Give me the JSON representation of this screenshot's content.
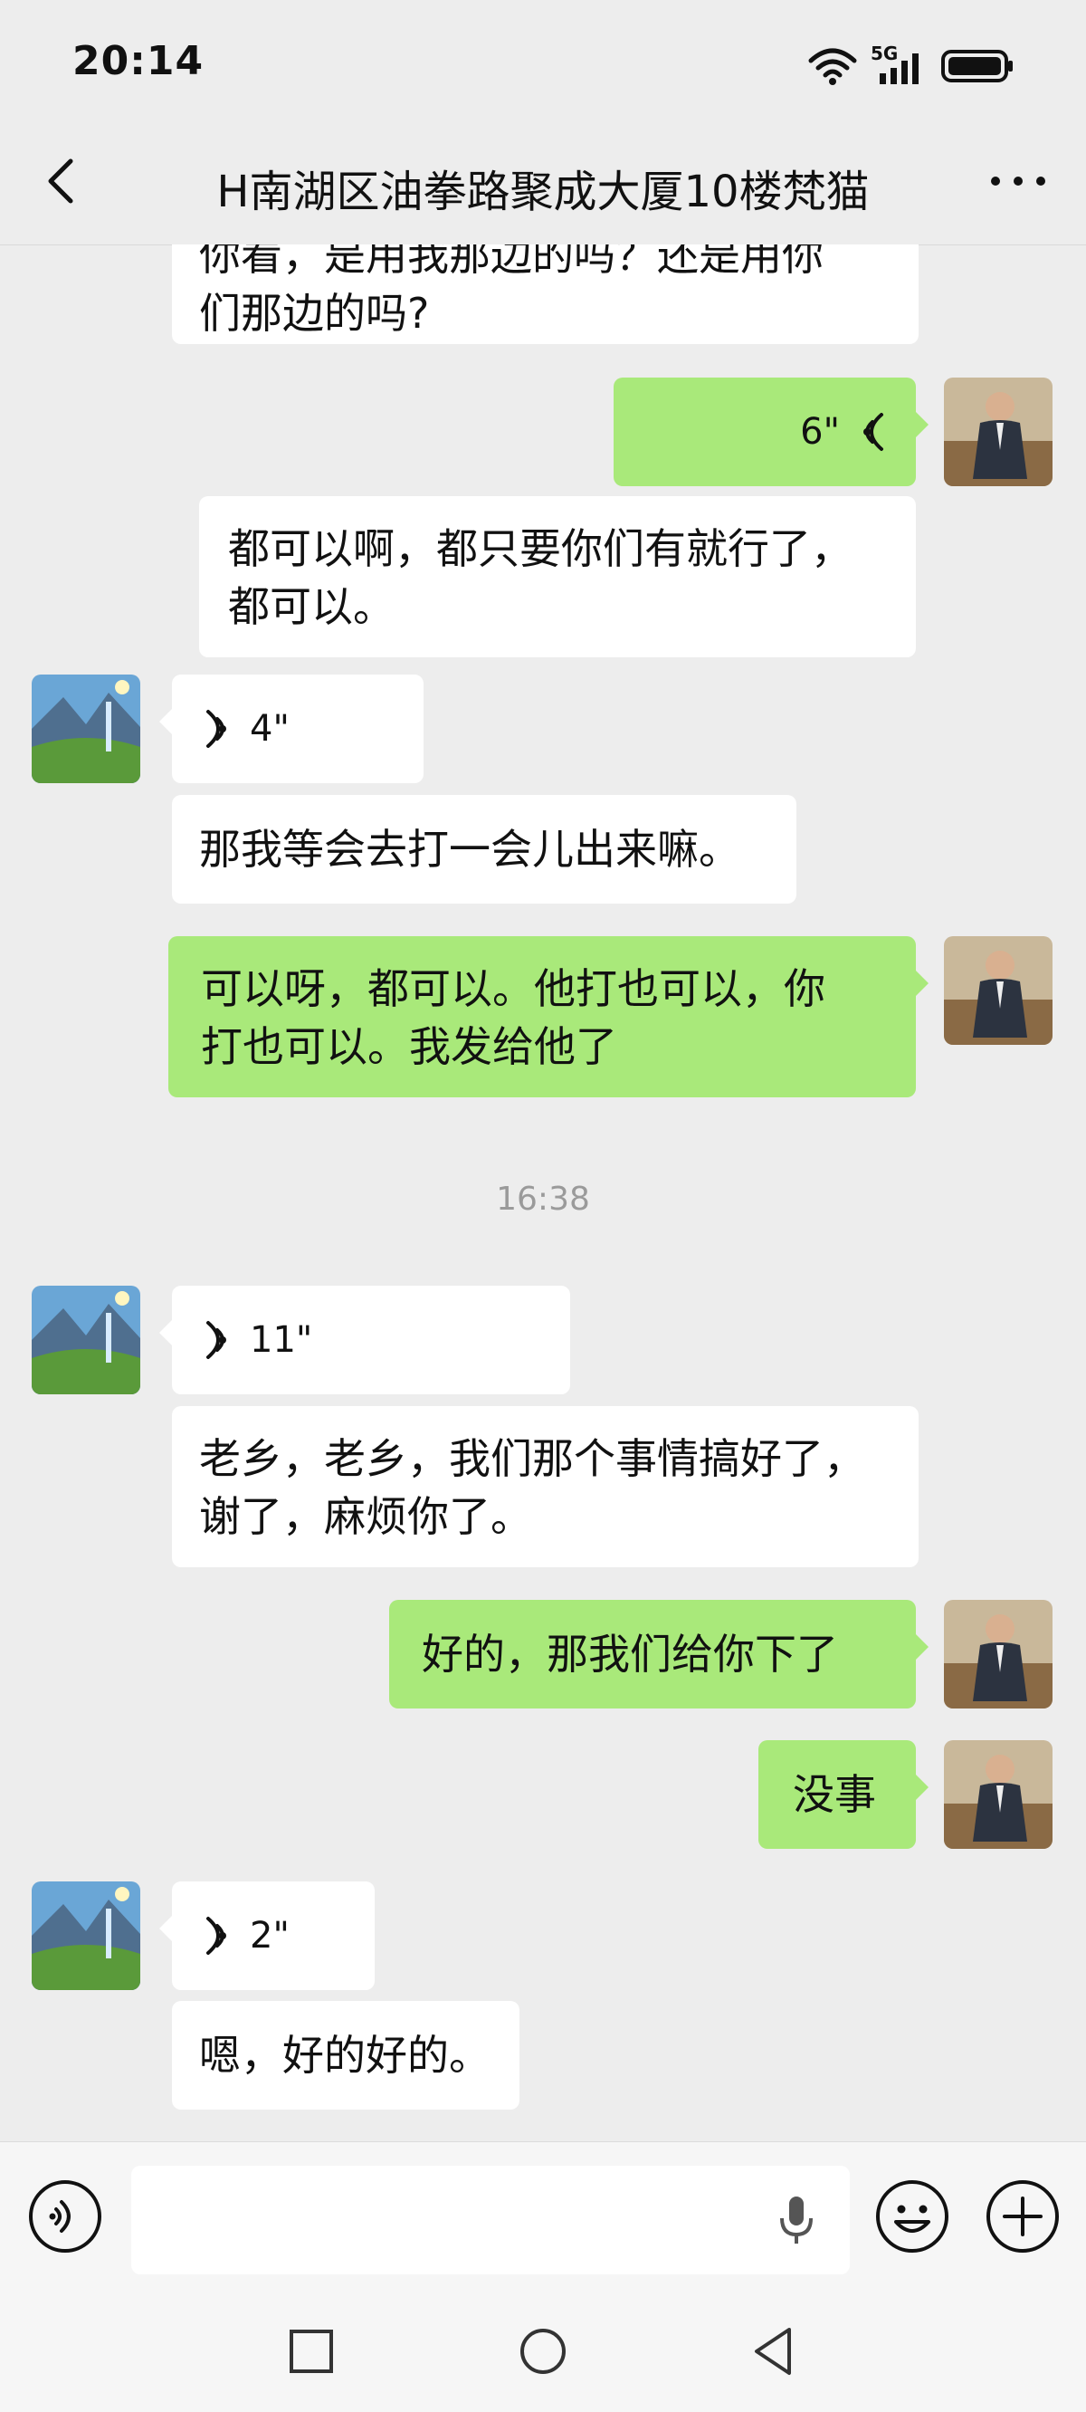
{
  "status_bar": {
    "time": "20:14",
    "network_label": "5G",
    "icons": [
      "wifi-icon",
      "cellular-signal-icon",
      "battery-icon"
    ]
  },
  "header": {
    "title": "H南湖区油拳路聚成大厦10楼梵猫",
    "back_icon": "chevron-left-icon",
    "more_icon": "more-dots-icon"
  },
  "messages": [
    {
      "side": "in",
      "type": "text",
      "text_line1": "你看，是用我那边的吗？还是用你",
      "text_line2": "们那边的吗?"
    },
    {
      "side": "out",
      "type": "voice",
      "duration": "6\""
    },
    {
      "side": "in",
      "type": "text",
      "text_line1": "都可以啊，都只要你们有就行了，",
      "text_line2": "都可以。"
    },
    {
      "side": "in",
      "type": "voice",
      "duration": "4\""
    },
    {
      "side": "in",
      "type": "text",
      "text": "那我等会去打一会儿出来嘛。"
    },
    {
      "side": "out",
      "type": "text",
      "text_line1": "可以呀，都可以。他打也可以，你",
      "text_line2": "打也可以。我发给他了"
    },
    {
      "type": "timestamp",
      "text": "16:38"
    },
    {
      "side": "in",
      "type": "voice",
      "duration": "11\""
    },
    {
      "side": "in",
      "type": "text",
      "text_line1": "老乡，老乡，我们那个事情搞好了，",
      "text_line2": "谢了，麻烦你了。"
    },
    {
      "side": "out",
      "type": "text",
      "text": "好的，那我们给你下了"
    },
    {
      "side": "out",
      "type": "text",
      "text": "没事"
    },
    {
      "side": "in",
      "type": "voice",
      "duration": "2\""
    },
    {
      "side": "in",
      "type": "text",
      "text": "嗯，好的好的。"
    }
  ],
  "input_bar": {
    "voice_toggle_icon": "voice-mode-icon",
    "placeholder": "",
    "mic_icon": "microphone-icon",
    "emoji_icon": "emoji-icon",
    "plus_icon": "plus-icon"
  },
  "nav_bar": {
    "icons": [
      "recent-apps-icon",
      "home-icon",
      "back-icon"
    ]
  },
  "colors": {
    "background": "#ededed",
    "outgoing_bubble": "#a9e97a",
    "incoming_bubble": "#ffffff",
    "timestamp_text": "#9a9a9a"
  }
}
